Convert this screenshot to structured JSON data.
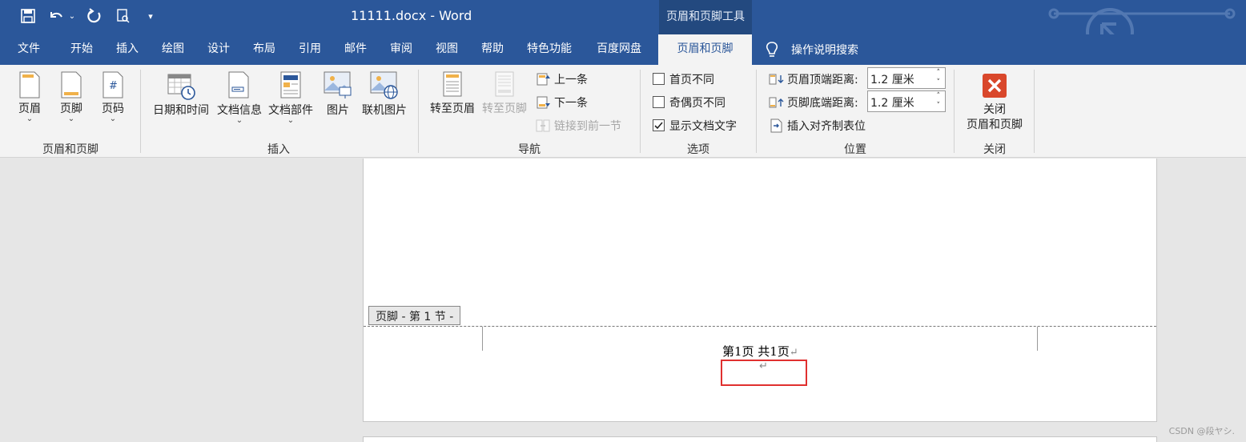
{
  "titlebar": {
    "doc_title": "11111.docx  -  Word",
    "context_tools": "页眉和页脚工具"
  },
  "tabs": [
    "文件",
    "开始",
    "插入",
    "绘图",
    "设计",
    "布局",
    "引用",
    "邮件",
    "审阅",
    "视图",
    "帮助",
    "特色功能",
    "百度网盘",
    "页眉和页脚"
  ],
  "tell_me": "操作说明搜索",
  "ribbon": {
    "hf_group": {
      "label": "页眉和页脚",
      "header": "页眉",
      "footer": "页脚",
      "page_number": "页码"
    },
    "insert_group": {
      "label": "插入",
      "date_time": "日期和时间",
      "doc_info": "文档信息",
      "quick_parts": "文档部件",
      "pictures": "图片",
      "online_pictures": "联机图片"
    },
    "nav_group": {
      "label": "导航",
      "goto_header": "转至页眉",
      "goto_footer": "转至页脚",
      "previous": "上一条",
      "next": "下一条",
      "link_previous": "链接到前一节"
    },
    "options_group": {
      "label": "选项",
      "different_first": "首页不同",
      "different_odd_even": "奇偶页不同",
      "show_doc_text": "显示文档文字",
      "different_first_checked": false,
      "different_odd_even_checked": false,
      "show_doc_text_checked": true
    },
    "position_group": {
      "label": "位置",
      "header_top_label": "页眉顶端距离:",
      "header_top_value": "1.2 厘米",
      "footer_bottom_label": "页脚底端距离:",
      "footer_bottom_value": "1.2 厘米",
      "insert_align_tab": "插入对齐制表位"
    },
    "close_group": {
      "label": "关闭",
      "close_line1": "关闭",
      "close_line2": "页眉和页脚"
    }
  },
  "document": {
    "footer_tag": "页脚 - 第 1 节 -",
    "footer_text": "第1页  共1页",
    "para_mark": "↵"
  },
  "watermark": "CSDN @段ヤシ.",
  "colors": {
    "title_blue": "#2b579a",
    "highlight_red": "#e0302f",
    "close_red": "#d9472b"
  }
}
